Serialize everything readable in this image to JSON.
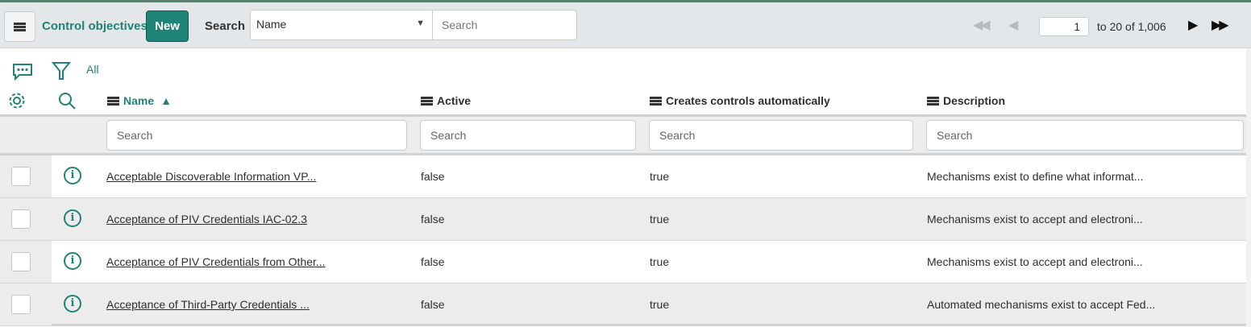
{
  "header": {
    "title": "Control objectives",
    "new_label": "New",
    "search_label": "Search",
    "search_field": "Name",
    "search_placeholder": "Search",
    "page_value": "1",
    "page_text": "to 20 of 1,006"
  },
  "toolbar": {
    "filter_label": "All"
  },
  "columns": [
    {
      "label": "Name",
      "sort": "▲"
    },
    {
      "label": "Active"
    },
    {
      "label": "Creates controls automatically"
    },
    {
      "label": "Description"
    }
  ],
  "filter_placeholder": "Search",
  "rows": [
    {
      "name": "Acceptable Discoverable Information VP...",
      "active": "false",
      "auto": "true",
      "desc": "Mechanisms exist to define what informat..."
    },
    {
      "name": "Acceptance of PIV Credentials IAC-02.3",
      "active": "false",
      "auto": "true",
      "desc": "Mechanisms exist to accept and electroni..."
    },
    {
      "name": "Acceptance of PIV Credentials from Other...",
      "active": "false",
      "auto": "true",
      "desc": "Mechanisms exist to accept and electroni..."
    },
    {
      "name": "Acceptance of Third-Party Credentials ...",
      "active": "false",
      "auto": "true",
      "desc": "Automated mechanisms exist to accept Fed..."
    }
  ],
  "colors": {
    "accent": "#1f8476",
    "header_bg": "#e4e7ea"
  }
}
